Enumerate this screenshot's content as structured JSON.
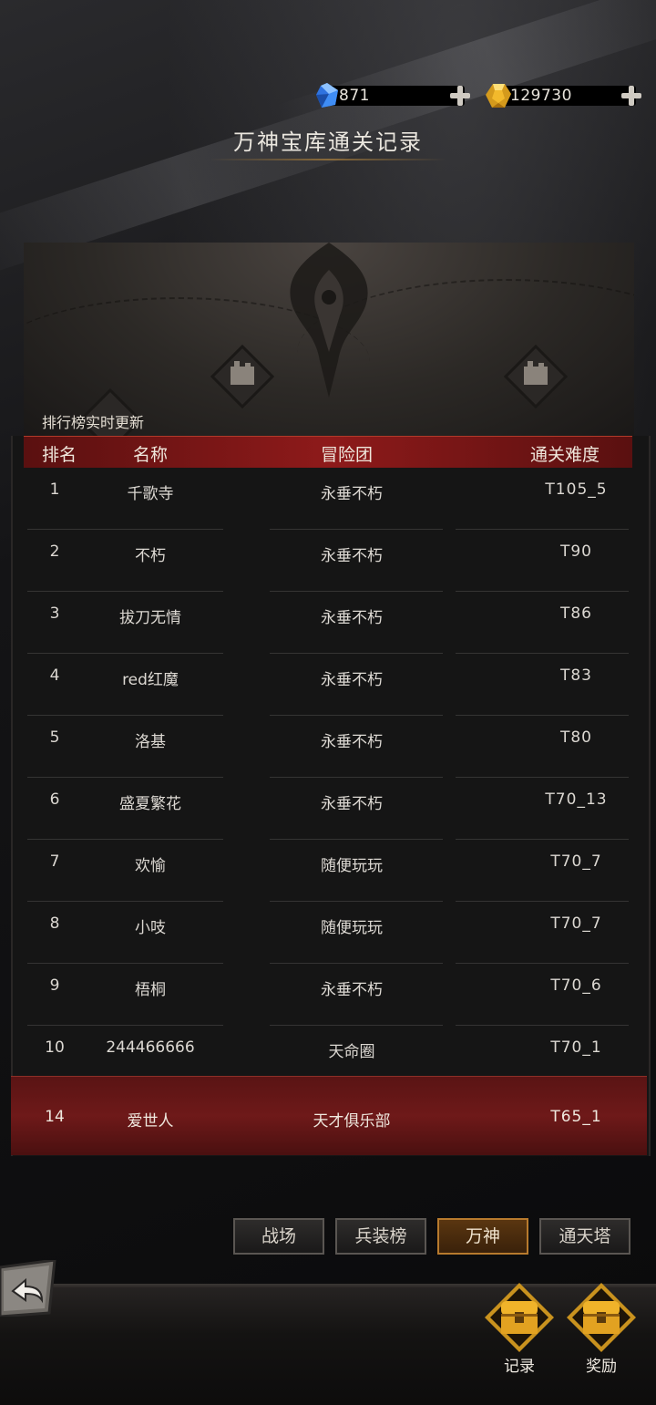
{
  "currency": {
    "gems": "871",
    "gold": "129730"
  },
  "title": "万神宝库通关记录",
  "subtitle": "排行榜实时更新",
  "table": {
    "headers": {
      "rank": "排名",
      "name": "名称",
      "guild": "冒险团",
      "difficulty": "通关难度"
    },
    "rows": [
      {
        "rank": "1",
        "name": "千歌寺",
        "guild": "永垂不朽",
        "difficulty": "T105_5"
      },
      {
        "rank": "2",
        "name": "不朽",
        "guild": "永垂不朽",
        "difficulty": "T90"
      },
      {
        "rank": "3",
        "name": "拔刀无情",
        "guild": "永垂不朽",
        "difficulty": "T86"
      },
      {
        "rank": "4",
        "name": "red红魔",
        "guild": "永垂不朽",
        "difficulty": "T83"
      },
      {
        "rank": "5",
        "name": "洛基",
        "guild": "永垂不朽",
        "difficulty": "T80"
      },
      {
        "rank": "6",
        "name": "盛夏繁花",
        "guild": "永垂不朽",
        "difficulty": "T70_13"
      },
      {
        "rank": "7",
        "name": "欢愉",
        "guild": "随便玩玩",
        "difficulty": "T70_7"
      },
      {
        "rank": "8",
        "name": "小吱",
        "guild": "随便玩玩",
        "difficulty": "T70_7"
      },
      {
        "rank": "9",
        "name": "梧桐",
        "guild": "永垂不朽",
        "difficulty": "T70_6"
      },
      {
        "rank": "10",
        "name": "244466666",
        "guild": "天命圈",
        "difficulty": "T70_1"
      }
    ],
    "self": {
      "rank": "14",
      "name": "爱世人",
      "guild": "天才俱乐部",
      "difficulty": "T65_1"
    }
  },
  "tabs": [
    {
      "label": "战场",
      "active": false
    },
    {
      "label": "兵装榜",
      "active": false
    },
    {
      "label": "万神",
      "active": true
    },
    {
      "label": "通天塔",
      "active": false
    }
  ],
  "actions": {
    "record_label": "记录",
    "reward_label": "奖励"
  },
  "icons": {
    "gem": "blue-crystal-icon",
    "gold": "gold-crystal-icon",
    "back": "back-arrow-icon",
    "chest": "treasure-chest-icon"
  },
  "colors": {
    "header_red": "#8e1a1a",
    "self_row_red": "#6e1919",
    "active_tab_border": "#b77a2d"
  }
}
